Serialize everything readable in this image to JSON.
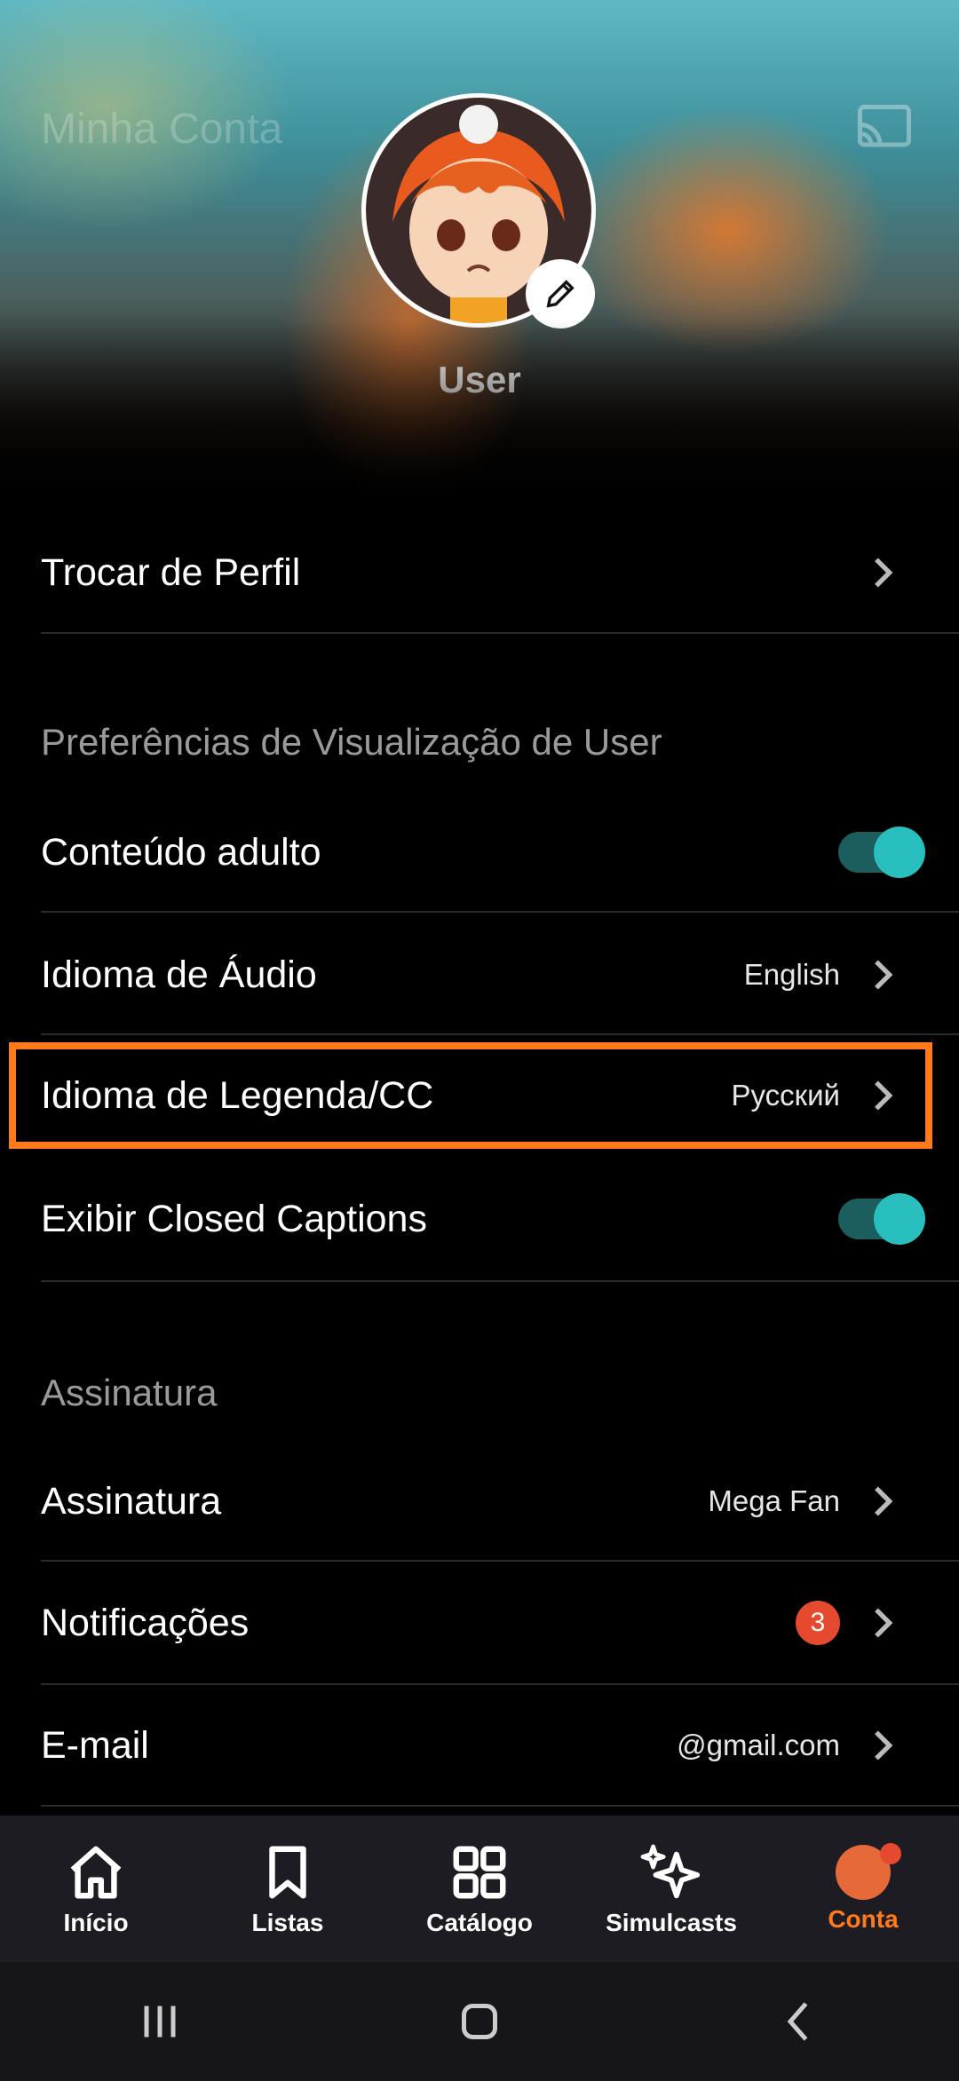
{
  "header": {
    "title": "Minha Conta",
    "profile_name": "User"
  },
  "profile": {
    "switch_label": "Trocar de Perfil"
  },
  "preferences": {
    "section_title": "Preferências de Visualização de User",
    "adult_content": {
      "label": "Conteúdo adulto",
      "enabled": true
    },
    "audio_language": {
      "label": "Idioma de Áudio",
      "value": "English"
    },
    "subtitle_language": {
      "label": "Idioma de Legenda/CC",
      "value": "Русский"
    },
    "closed_captions": {
      "label": "Exibir Closed Captions",
      "enabled": true
    }
  },
  "subscription": {
    "section_title": "Assinatura",
    "plan": {
      "label": "Assinatura",
      "value": "Mega Fan"
    },
    "notifications": {
      "label": "Notificações",
      "count": "3"
    },
    "email": {
      "label": "E-mail",
      "value": "@gmail.com"
    }
  },
  "bottom_nav": {
    "items": [
      {
        "label": "Início",
        "icon": "home-icon"
      },
      {
        "label": "Listas",
        "icon": "bookmark-icon"
      },
      {
        "label": "Catálogo",
        "icon": "grid-icon"
      },
      {
        "label": "Simulcasts",
        "icon": "sparkle-icon"
      },
      {
        "label": "Conta",
        "icon": "avatar-icon"
      }
    ],
    "active": "Conta"
  },
  "colors": {
    "accent": "#ff7a1a",
    "toggle_on": "#2abfbf",
    "badge": "#e64a2e",
    "nav_bg": "#1c1c22"
  }
}
